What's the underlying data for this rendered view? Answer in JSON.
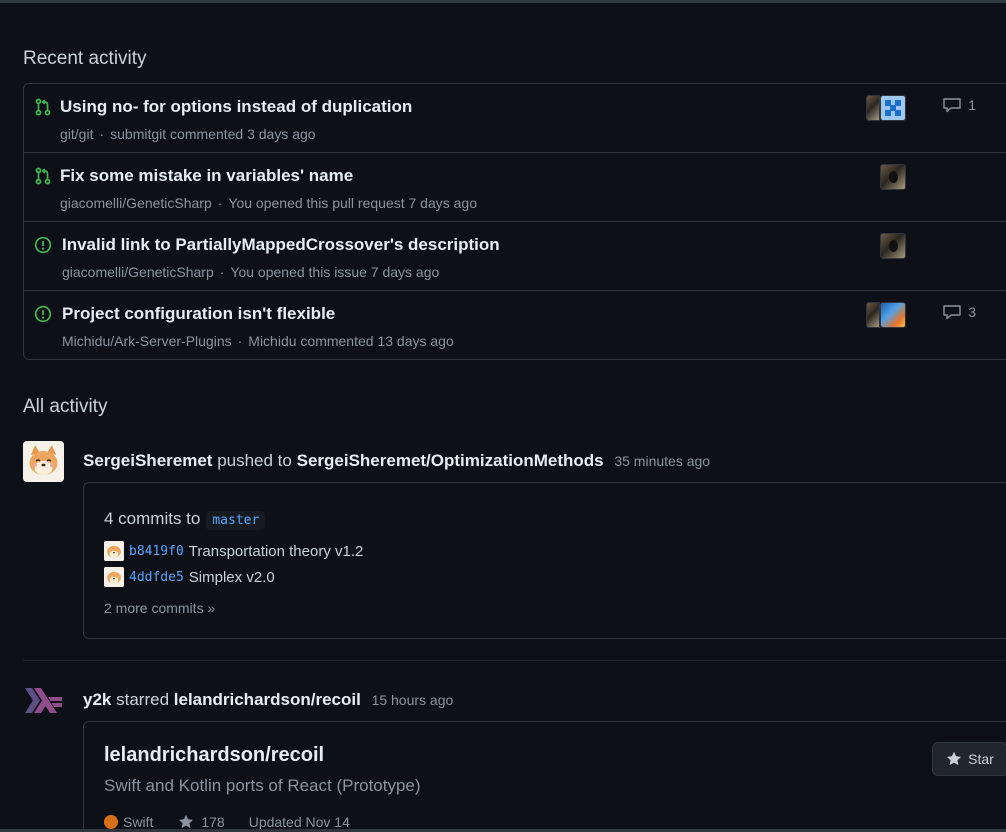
{
  "sections": {
    "recent_title": "Recent activity",
    "all_title": "All activity"
  },
  "recent": [
    {
      "type": "pull-request",
      "title": "Using no- for options instead of duplication",
      "repo": "git/git",
      "detail": "submitgit commented 3 days ago",
      "comments": "1",
      "status_color": "#3fb950"
    },
    {
      "type": "pull-request",
      "title": "Fix some mistake in variables' name",
      "repo": "giacomelli/GeneticSharp",
      "detail": "You opened this pull request 7 days ago",
      "comments": "",
      "status_color": "#3fb950"
    },
    {
      "type": "issue",
      "title": "Invalid link to PartiallyMappedCrossover's description",
      "repo": "giacomelli/GeneticSharp",
      "detail": "You opened this issue 7 days ago",
      "comments": "",
      "status_color": "#3fb950"
    },
    {
      "type": "issue",
      "title": "Project configuration isn't flexible",
      "repo": "Michidu/Ark-Server-Plugins",
      "detail": "Michidu commented 13 days ago",
      "comments": "3",
      "status_color": "#3fb950"
    }
  ],
  "push_event": {
    "user": "SergeiSheremet",
    "verb": "pushed to",
    "repo": "SergeiSheremet/OptimizationMethods",
    "time": "35 minutes ago",
    "commits_label": "4 commits to",
    "branch": "master",
    "commits": [
      {
        "sha": "b8419f0",
        "message": "Transportation theory v1.2"
      },
      {
        "sha": "4ddfde5",
        "message": "Simplex v2.0"
      }
    ],
    "more": "2 more commits »"
  },
  "star_event": {
    "user": "y2k",
    "verb": "starred",
    "repo": "lelandrichardson/recoil",
    "time": "15 hours ago",
    "card": {
      "name": "lelandrichardson/recoil",
      "description": "Swift and Kotlin ports of React (Prototype)",
      "language": "Swift",
      "language_color": "#d96e18",
      "stars": "178",
      "updated": "Updated Nov 14",
      "star_button": "Star"
    }
  },
  "colors": {
    "background": "#0d1117",
    "border": "#30363d",
    "link": "#58a6ff",
    "muted": "#8b949e",
    "open": "#3fb950"
  }
}
